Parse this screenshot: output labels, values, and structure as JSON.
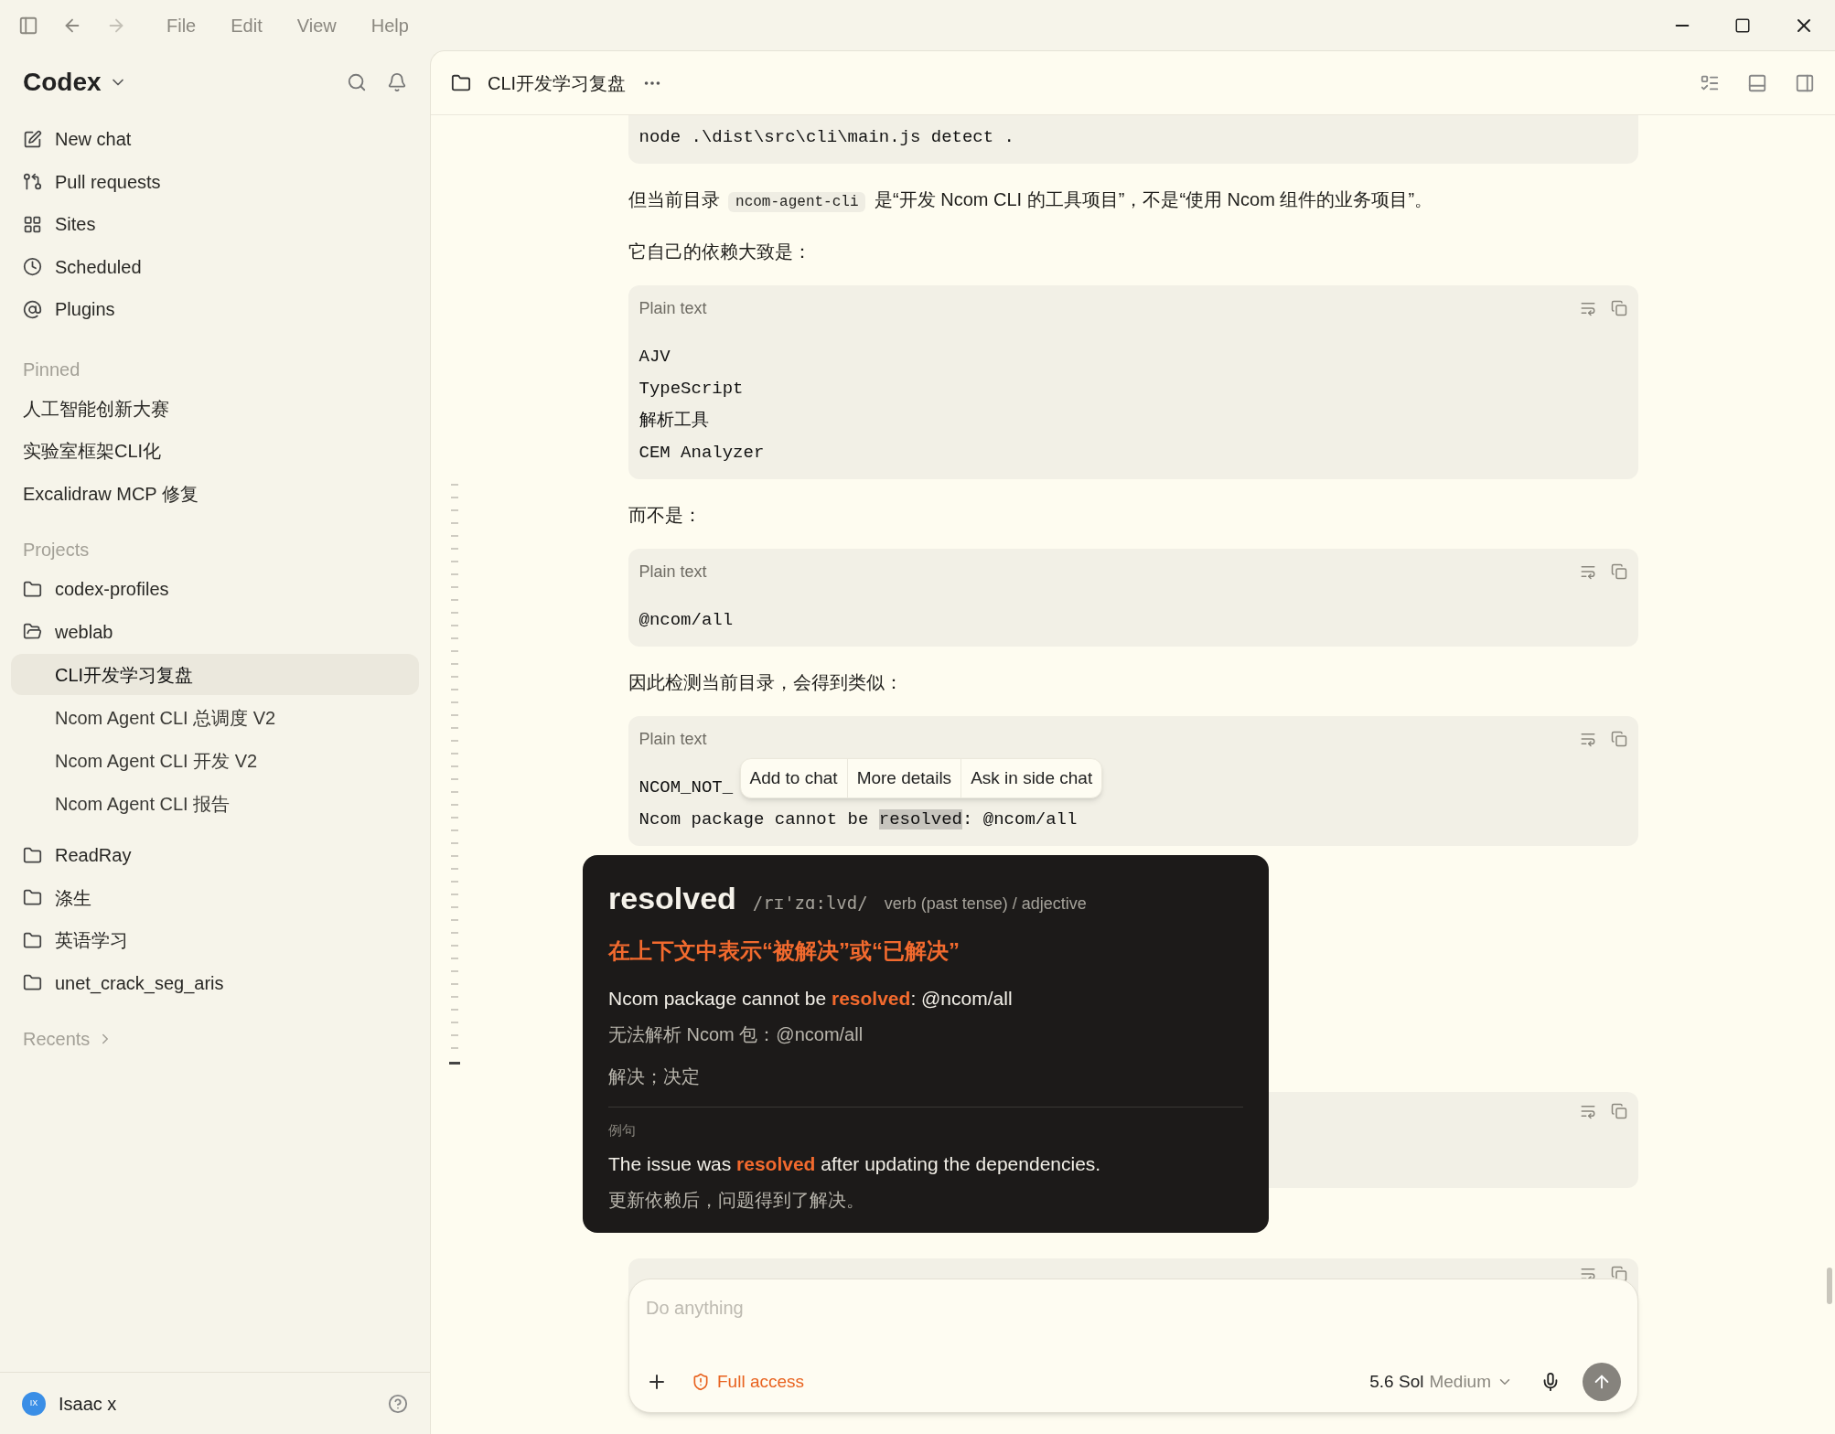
{
  "menu_bar": {
    "items": [
      "File",
      "Edit",
      "View",
      "Help"
    ]
  },
  "sidebar": {
    "title": "Codex",
    "nav": [
      {
        "label": "New chat"
      },
      {
        "label": "Pull requests"
      },
      {
        "label": "Sites"
      },
      {
        "label": "Scheduled"
      },
      {
        "label": "Plugins"
      }
    ],
    "pinned": {
      "heading": "Pinned",
      "items": [
        "人工智能创新大赛",
        "实验室框架CLI化",
        "Excalidraw MCP 修复"
      ]
    },
    "projects": {
      "heading": "Projects",
      "items": [
        {
          "label": "codex-profiles",
          "expanded": false
        },
        {
          "label": "weblab",
          "expanded": true,
          "children": [
            {
              "label": "CLI开发学习复盘",
              "selected": true
            },
            {
              "label": "Ncom Agent CLI 总调度 V2",
              "selected": false
            },
            {
              "label": "Ncom Agent CLI 开发 V2",
              "selected": false
            },
            {
              "label": "Ncom Agent CLI 报告",
              "selected": false
            }
          ]
        },
        {
          "label": "ReadRay",
          "expanded": false
        },
        {
          "label": "涤生",
          "expanded": false
        },
        {
          "label": "英语学习",
          "expanded": false
        },
        {
          "label": "unet_crack_seg_aris",
          "expanded": false
        }
      ]
    },
    "recents": {
      "heading": "Recents"
    },
    "user": {
      "initials": "IX",
      "name": "Isaac x"
    }
  },
  "chat": {
    "title": "CLI开发学习复盘",
    "blocks": [
      {
        "kind": "code",
        "lines": [
          "node .\\dist\\src\\cli\\main.js detect ."
        ]
      },
      {
        "kind": "paragraph",
        "segments": [
          {
            "kind": "text",
            "text": "但当前目录 "
          },
          {
            "kind": "code",
            "text": "ncom-agent-cli"
          },
          {
            "kind": "text",
            "text": " 是“开发 Ncom CLI 的工具项目”，不是“使用 Ncom 组件的业务项目”。"
          }
        ]
      },
      {
        "kind": "paragraph",
        "segments": [
          {
            "kind": "text",
            "text": "它自己的依赖大致是："
          }
        ]
      },
      {
        "kind": "code",
        "label": "Plain text",
        "lines": [
          "AJV",
          "TypeScript",
          "解析工具",
          "CEM Analyzer"
        ]
      },
      {
        "kind": "paragraph",
        "segments": [
          {
            "kind": "text",
            "text": "而不是："
          }
        ]
      },
      {
        "kind": "code",
        "label": "Plain text",
        "lines": [
          "@ncom/all"
        ]
      },
      {
        "kind": "paragraph",
        "segments": [
          {
            "kind": "text",
            "text": "因此检测当前目录，会得到类似："
          }
        ]
      },
      {
        "kind": "code",
        "label": "Plain text",
        "lines": [
          "NCOM_NOT_",
          [
            {
              "text": "Ncom package cannot be ",
              "highlighted": false
            },
            {
              "text": "resolved",
              "highlighted": true
            },
            {
              "text": ": @ncom/all",
              "highlighted": false
            }
          ]
        ],
        "selection_menu": [
          "Add to chat",
          "More details",
          "Ask in side chat"
        ]
      },
      {
        "kind": "covered_code"
      },
      {
        "kind": "code_tail"
      }
    ]
  },
  "lookup": {
    "word": "resolved",
    "phonetic": "/rɪ'zɑ:lvd/",
    "pos": "verb (past tense) / adjective",
    "meaning": "在上下文中表示“被解决”或“已解决”",
    "context": [
      {
        "text": "Ncom package cannot be ",
        "highlighted": false
      },
      {
        "text": "resolved",
        "highlighted": true
      },
      {
        "text": ": @ncom/all",
        "highlighted": false
      }
    ],
    "context_translation": "无法解析 Ncom 包：@ncom/all",
    "senses": "解决；决定",
    "example_heading": "例句",
    "example": [
      {
        "text": "The issue was ",
        "highlighted": false
      },
      {
        "text": "resolved",
        "highlighted": true
      },
      {
        "text": " after updating the dependencies.",
        "highlighted": false
      }
    ],
    "example_translation": "更新依赖后，问题得到了解决。"
  },
  "composer": {
    "placeholder": "Do anything",
    "access": "Full access",
    "model": "5.6 Sol",
    "effort": "Medium"
  }
}
